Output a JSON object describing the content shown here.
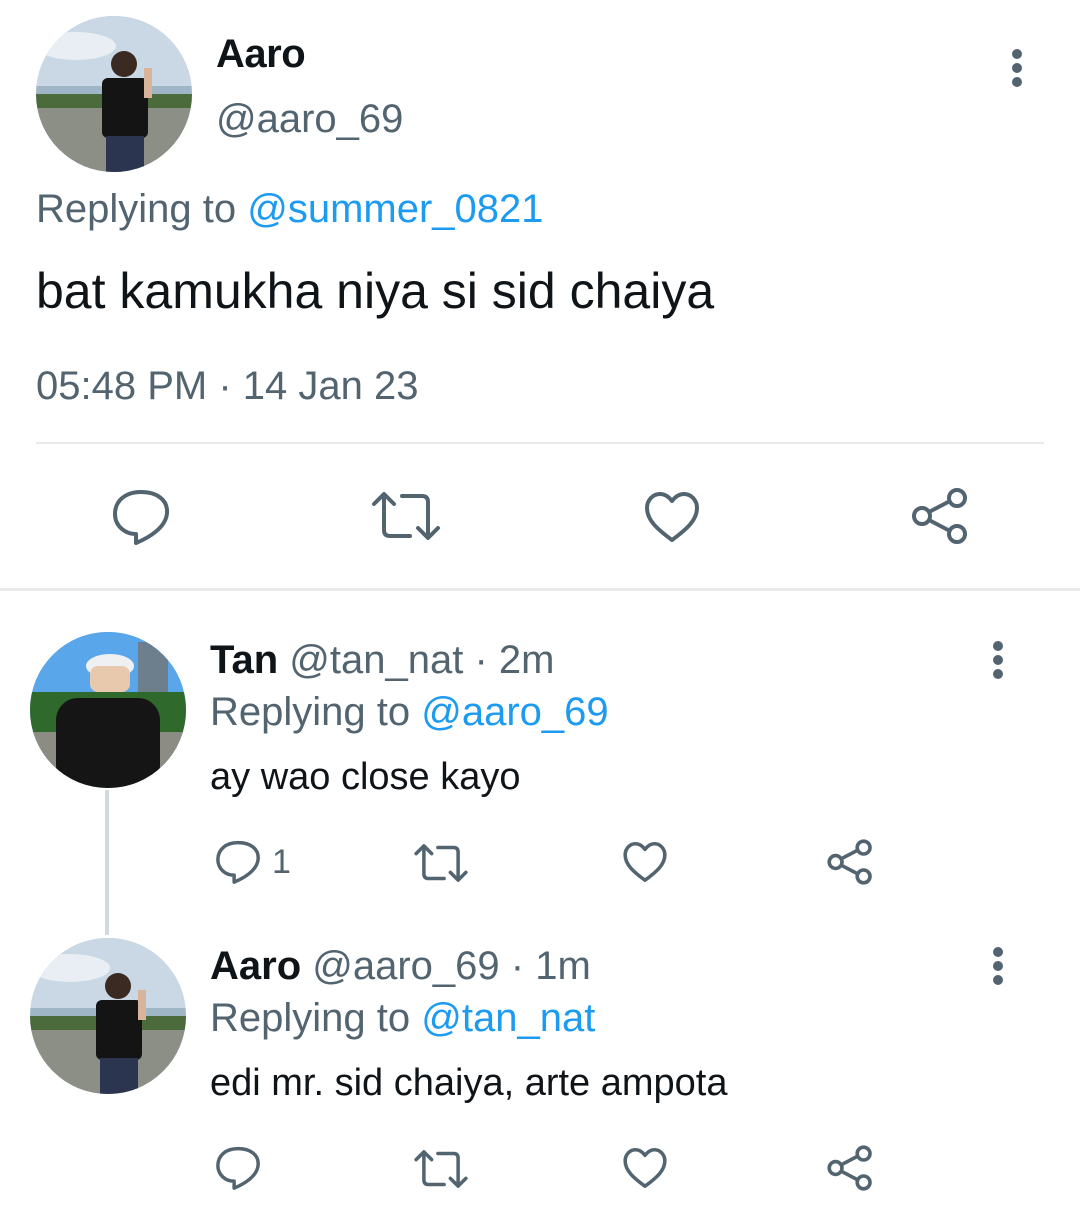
{
  "main_tweet": {
    "display_name": "Aaro",
    "handle": "@aaro_69",
    "replying_label": "Replying to",
    "replying_to": "@summer_0821",
    "text": "bat kamukha niya si sid chaiya",
    "timestamp": "05:48 PM · 14 Jan 23",
    "actions": [
      "reply",
      "retweet",
      "like",
      "share"
    ]
  },
  "replies": [
    {
      "display_name": "Tan",
      "handle": "@tan_nat",
      "time": "· 2m",
      "replying_label": "Replying to",
      "replying_to": "@aaro_69",
      "text": "ay wao close kayo",
      "reply_count": "1"
    },
    {
      "display_name": "Aaro",
      "handle": "@aaro_69",
      "time": "· 1m",
      "replying_label": "Replying to",
      "replying_to": "@tan_nat",
      "text": "edi mr. sid chaiya, arte ampota",
      "reply_count": ""
    }
  ],
  "icons": {
    "more": "more-vertical-icon",
    "reply": "reply-bubble-icon",
    "retweet": "retweet-icon",
    "like": "heart-icon",
    "share": "share-icon"
  },
  "colors": {
    "text": "#0f1419",
    "secondary": "#536471",
    "link": "#1d9bf0",
    "divider": "#e7e9eb"
  }
}
